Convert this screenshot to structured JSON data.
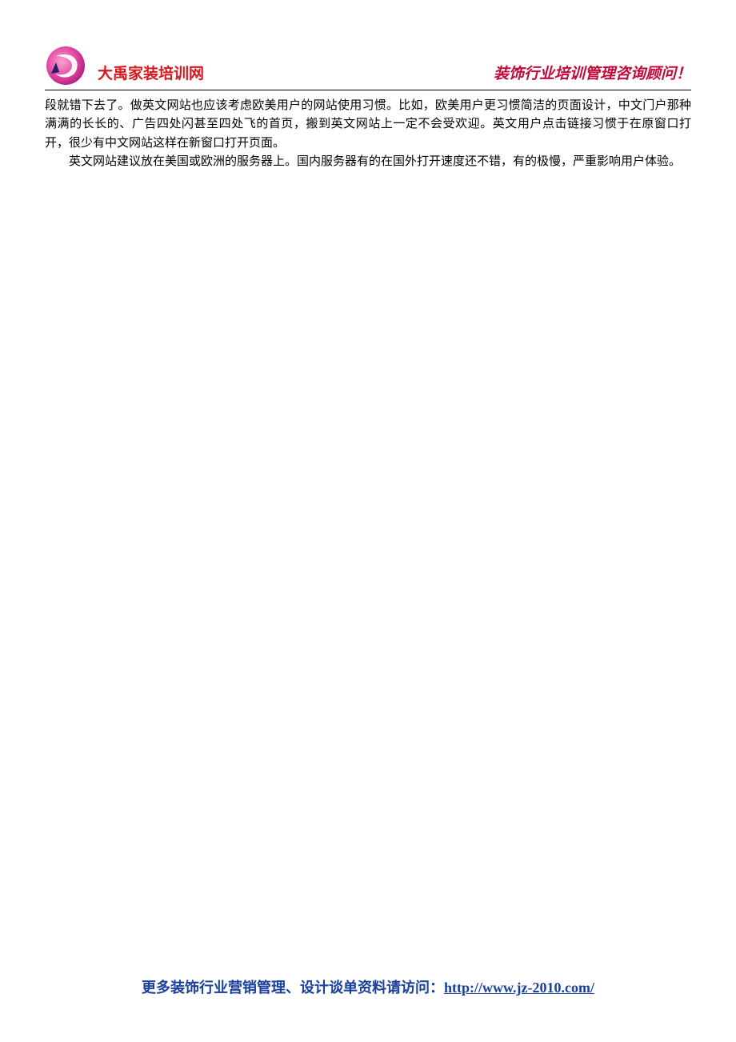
{
  "header": {
    "site_title": "大禹家装培训网",
    "tagline": "装饰行业培训管理咨询顾问！"
  },
  "body": {
    "p1": "段就错下去了。做英文网站也应该考虑欧美用户的网站使用习惯。比如，欧美用户更习惯简洁的页面设计，中文门户那种满满的长长的、广告四处闪甚至四处飞的首页，搬到英文网站上一定不会受欢迎。英文用户点击链接习惯于在原窗口打开，很少有中文网站这样在新窗口打开页面。",
    "p2": "英文网站建议放在美国或欧洲的服务器上。国内服务器有的在国外打开速度还不错，有的极慢，严重影响用户体验。"
  },
  "footer": {
    "prefix": "更多装饰行业营销管理、设计谈单资料请访问：",
    "url": "http://www.jz-2010.com/"
  }
}
